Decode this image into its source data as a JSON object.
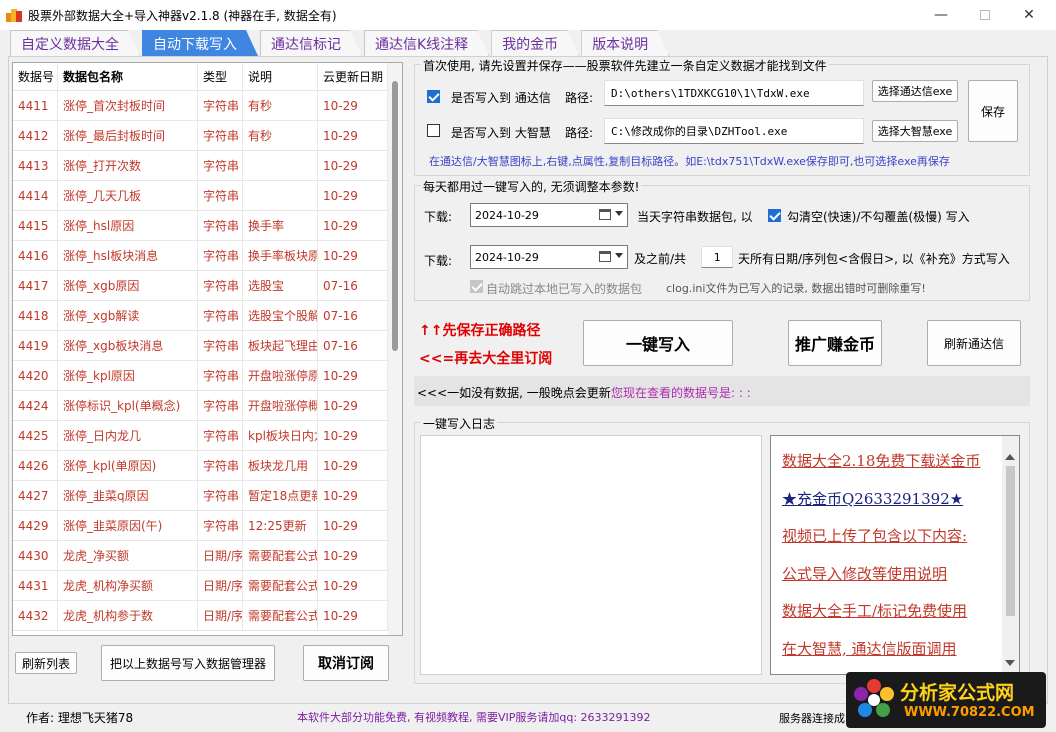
{
  "window": {
    "title": "股票外部数据大全+导入神器v2.1.8 (神器在手, 数据全有)",
    "minimize": "—",
    "close": "✕"
  },
  "tabs": [
    {
      "label": "自定义数据大全",
      "active": false
    },
    {
      "label": "自动下载写入",
      "active": true
    },
    {
      "label": "通达信标记",
      "active": false
    },
    {
      "label": "通达信K线注释",
      "active": false
    },
    {
      "label": "我的金币",
      "active": false
    },
    {
      "label": "版本说明",
      "active": false
    }
  ],
  "table": {
    "headers": [
      "数据号",
      "数据包名称",
      "类型",
      "说明",
      "云更新日期"
    ],
    "rows": [
      [
        "4411",
        "涨停_首次封板时间",
        "字符串",
        "有秒",
        "10-29"
      ],
      [
        "4412",
        "涨停_最后封板时间",
        "字符串",
        "有秒",
        "10-29"
      ],
      [
        "4413",
        "涨停_打开次数",
        "字符串",
        "",
        "10-29"
      ],
      [
        "4414",
        "涨停_几天几板",
        "字符串",
        "",
        "10-29"
      ],
      [
        "4415",
        "涨停_hsl原因",
        "字符串",
        "换手率",
        "10-29"
      ],
      [
        "4416",
        "涨停_hsl板块消息",
        "字符串",
        "换手率板块原",
        "10-29"
      ],
      [
        "4417",
        "涨停_xgb原因",
        "字符串",
        "选股宝",
        "07-16"
      ],
      [
        "4418",
        "涨停_xgb解读",
        "字符串",
        "选股宝个股解",
        "07-16"
      ],
      [
        "4419",
        "涨停_xgb板块消息",
        "字符串",
        "板块起飞理由",
        "07-16"
      ],
      [
        "4420",
        "涨停_kpl原因",
        "字符串",
        "开盘啦涨停原",
        "10-29"
      ],
      [
        "4424",
        "涨停标识_kpl(单概念)",
        "字符串",
        "开盘啦涨停概",
        "10-29"
      ],
      [
        "4425",
        "涨停_日内龙几",
        "字符串",
        "kpl板块日内龙",
        "10-29"
      ],
      [
        "4426",
        "涨停_kpl(单原因)",
        "字符串",
        "板块龙几用",
        "10-29"
      ],
      [
        "4427",
        "涨停_韭菜q原因",
        "字符串",
        "暂定18点更新",
        "10-29"
      ],
      [
        "4429",
        "涨停_韭菜原因(午)",
        "字符串",
        "12:25更新",
        "10-29"
      ],
      [
        "4430",
        "龙虎_净买额",
        "日期/序",
        "需要配套公式",
        "10-29"
      ],
      [
        "4431",
        "龙虎_机构净买额",
        "日期/序",
        "需要配套公式",
        "10-29"
      ],
      [
        "4432",
        "龙虎_机构参于数",
        "日期/序",
        "需要配套公式",
        "10-29"
      ]
    ]
  },
  "left_buttons": {
    "refresh_list": "刷新列表",
    "write_to_manager": "把以上数据号写入数据管理器",
    "cancel_subscribe": "取消订阅"
  },
  "setup": {
    "title": "首次使用, 请先设置并保存——股票软件先建立一条自定义数据才能找到文件",
    "tdx_checkbox_label": "是否写入到 通达信",
    "tdx_checked": true,
    "path_label": "路径:",
    "tdx_path": "D:\\others\\1TDXKCG10\\1\\TdxW.exe",
    "tdx_select": "选择通达信exe",
    "dzh_checkbox_label": "是否写入到 大智慧",
    "dzh_checked": false,
    "dzh_path": "C:\\修改成你的目录\\DZHTool.exe",
    "dzh_select": "选择大智慧exe",
    "save": "保存",
    "hint": "在通达信/大智慧图标上,右键,点属性,复制目标路径。如E:\\tdx751\\TdxW.exe保存即可,也可选择exe再保存",
    "hint_color": "#3a43c9"
  },
  "daily": {
    "title": "每天都用过一键写入的, 无须调整本参数!",
    "download_label": "下载:",
    "date1": "2024-10-29",
    "desc1": "当天字符串数据包, 以",
    "clear_checked": true,
    "clear_label": "勾清空(快速)/不勾覆盖(极慢) 写入",
    "date2": "2024-10-29",
    "desc2_prefix": "及之前/共",
    "days": "1",
    "desc2_suffix": "天所有日期/序列包<含假日>, 以《补充》方式写入",
    "skip_label": "自动跳过本地已写入的数据包",
    "clog_note": "clog.ini文件为已写入的记录, 数据出错时可删除重写!"
  },
  "actions": {
    "red_line1": "↑↑先保存正确路径",
    "red_line2": "<<=再去大全里订阅",
    "one_click": "一键写入",
    "promote": "推广赚金币",
    "refresh_tdx": "刷新通达信",
    "info_prefix": "<<<一如没有数据, 一般晚点会更新",
    "info_viewing": "您现在查看的数据号是: : :"
  },
  "log": {
    "title": "一键写入日志",
    "ads": [
      {
        "text": "数据大全2.18免费下载送金币",
        "color": "red"
      },
      {
        "text": "★充金币Q2633291392★",
        "color": "blue"
      },
      {
        "text": "视频已上传了包含以下内容:",
        "color": "red"
      },
      {
        "text": "公式导入修改等使用说明",
        "color": "red"
      },
      {
        "text": "数据大全手工/标记免费使用",
        "color": "red"
      },
      {
        "text": "在大智慧, 通达信版面调用",
        "color": "red"
      }
    ]
  },
  "status": {
    "author": "作者: 理想飞天猪78",
    "notice": "本软件大部分功能免费, 有视频教程, 需要VIP服务请加qq: 2633291392",
    "server": "服务器连接成"
  },
  "logo": {
    "brand": "分析家公式网",
    "url": "WWW.70822.COM"
  },
  "colors": {
    "accent": "#3e86e0",
    "tab_text": "#6b2fa0",
    "row_text": "#c0392b",
    "notice_text": "#7b1fa2"
  }
}
